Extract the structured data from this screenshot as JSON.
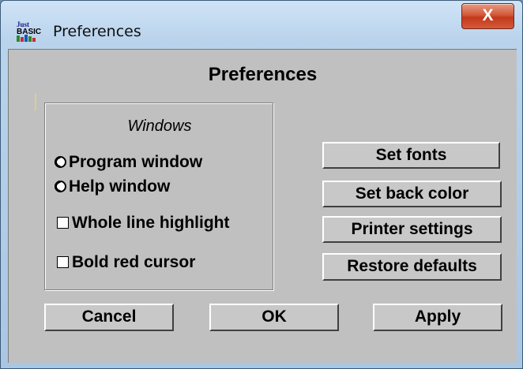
{
  "window": {
    "title": "Preferences",
    "close_label": "X",
    "app_icon": "justbasic-icon",
    "app_icon_text": "Just BASIC"
  },
  "dialog": {
    "heading": "Preferences",
    "group": {
      "title": "Windows",
      "options": [
        {
          "type": "radio",
          "label": "Program window",
          "selected": false
        },
        {
          "type": "radio",
          "label": "Help window",
          "selected": false
        },
        {
          "type": "checkbox",
          "label": "Whole line highlight",
          "checked": false
        },
        {
          "type": "checkbox",
          "label": "Bold red cursor",
          "checked": false
        }
      ]
    },
    "side_buttons": {
      "set_fonts": "Set fonts",
      "set_back_color": "Set back color",
      "printer_settings": "Printer settings",
      "restore_defaults": "Restore defaults"
    },
    "bottom_buttons": {
      "cancel": "Cancel",
      "ok": "OK",
      "apply": "Apply"
    }
  },
  "colors": {
    "dialog_bg": "#c0c0c0",
    "titlebar": "#b9d3ec",
    "close_button": "#c2391b"
  }
}
